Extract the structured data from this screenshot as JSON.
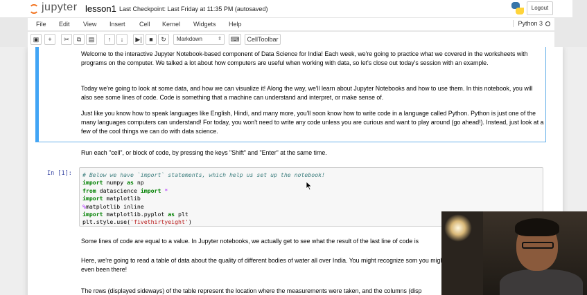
{
  "header": {
    "logo_text": "jupyter",
    "notebook_name": "lesson1",
    "checkpoint": "Last Checkpoint: Last Friday at 11:35 PM (autosaved)",
    "logout": "Logout"
  },
  "menubar": {
    "items": [
      "File",
      "Edit",
      "View",
      "Insert",
      "Cell",
      "Kernel",
      "Widgets",
      "Help"
    ],
    "kernel": "Python 3"
  },
  "toolbar": {
    "cell_type": "Markdown",
    "celltoolbar": "CellToolbar",
    "icons": [
      "save-icon",
      "add-cell-icon",
      "cut-icon",
      "copy-icon",
      "paste-icon",
      "move-up-icon",
      "move-down-icon",
      "step-run-icon",
      "stop-icon",
      "restart-icon",
      "keyboard-icon"
    ]
  },
  "cells": {
    "md_p1": "Welcome to the interactive Jupyter Notebook-based component of Data Science for India! Each week, we're going to practice what we covered in the worksheets with programs on the computer. We talked a lot about how computers are useful when working with data, so let's close out today's session with an example.",
    "md_p2": "Today we're going to look at some data, and how we can visualize it! Along the way, we'll learn about Jupyter Notebooks and how to use them. In this notebook, you will also see some lines of code. Code is something that a machine can understand and interpret, or make sense of.",
    "md_p3": "Just like you know how to speak languages like English, Hindi, and many more, you'll soon know how to write code in a language called Python. Python is just one of the many languages computers can understand! For today, you won't need to write any code unless you are curious and want to play around (go ahead!). Instead, just look at a few of the cool things we can do with data science.",
    "md_p4": "Run each \"cell\", or block of code, by pressing the keys \"Shift\" and \"Enter\" at the same time.",
    "code_prompt": "In [1]:",
    "code_lines": [
      "# Below we have `import` statements, which help us set up the notebook!",
      "import numpy as np",
      "from datascience import *",
      "import matplotlib",
      "%matplotlib inline",
      "import matplotlib.pyplot as plt",
      "plt.style.use('fivethirtyeight')"
    ],
    "md_p5": "Some lines of code are equal to a value. In Jupyter notebooks, we actually get to see what the result of the last line of code is",
    "md_p6": "Here, we're going to read a table of data about the quality of different bodies of water all over India. You might recognize som you might have even been there!",
    "md_p7": "The rows (displayed sideways) of the table represent the location where the measurements were taken, and the columns (disp"
  },
  "colors": {
    "selected_cell_border": "#42a5f5",
    "prompt": "#303f9f",
    "keyword": "#008000",
    "comment": "#408080",
    "magic": "#aa22ff",
    "string": "#ba2121"
  }
}
